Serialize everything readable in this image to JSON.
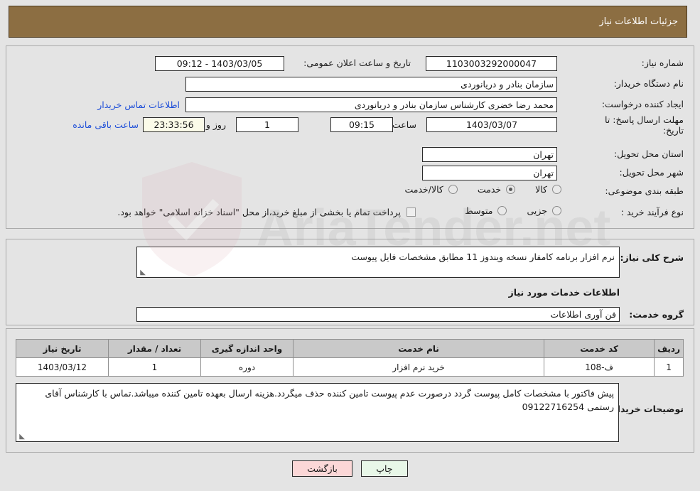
{
  "header": {
    "title": "جزئیات اطلاعات نیاز"
  },
  "form": {
    "need_number_label": "شماره نیاز:",
    "need_number_value": "1103003292000047",
    "announce_label": "تاریخ و ساعت اعلان عمومی:",
    "announce_value": "1403/03/05 - 09:12",
    "buyer_org_label": "نام دستگاه خریدار:",
    "buyer_org_value": "سازمان بنادر و دریانوردی",
    "creator_label": "ایجاد کننده درخواست:",
    "creator_value": "محمد رضا خضری کارشناس سازمان بنادر و دریانوردی",
    "contact_link": "اطلاعات تماس خریدار",
    "deadline_label": "مهلت ارسال پاسخ: تا تاریخ:",
    "deadline_date": "1403/03/07",
    "hour_label": "ساعت",
    "deadline_time": "09:15",
    "days_value": "1",
    "days_label": "روز و",
    "countdown_value": "23:33:56",
    "remaining_label": "ساعت باقی مانده",
    "province_label": "استان محل تحویل:",
    "province_value": "تهران",
    "city_label": "شهر محل تحویل:",
    "city_value": "تهران",
    "category_label": "طبقه بندی موضوعی:",
    "category_options": [
      {
        "label": "کالا",
        "selected": false
      },
      {
        "label": "خدمت",
        "selected": true
      },
      {
        "label": "کالا/خدمت",
        "selected": false
      }
    ],
    "process_label": "نوع فرآیند خرید :",
    "process_options": [
      {
        "label": "جزیی",
        "selected": false
      },
      {
        "label": "متوسط",
        "selected": false
      }
    ],
    "treasury_checkbox_checked": false,
    "treasury_text": "پرداخت تمام یا بخشی از مبلغ خرید،از محل \"اسناد خزانه اسلامی\" خواهد بود."
  },
  "description": {
    "need_desc_label": "شرح کلی نیاز:",
    "need_desc_value": "نرم افزار برنامه کامفار نسخه ویندوز 11 مطابق مشخصات فایل پیوست",
    "services_section_title": "اطلاعات خدمات مورد نیاز",
    "service_group_label": "گروه خدمت:",
    "service_group_value": "فن آوری اطلاعات"
  },
  "table": {
    "columns": [
      "ردیف",
      "کد خدمت",
      "نام خدمت",
      "واحد اندازه گیری",
      "تعداد / مقدار",
      "تاریخ نیاز"
    ],
    "rows": [
      {
        "radif": "1",
        "code": "ف-108",
        "name": "خرید نرم افزار",
        "unit": "دوره",
        "qty": "1",
        "date": "1403/03/12"
      }
    ],
    "notes_label": "توضیحات خریدار:",
    "notes_value": "پیش فاکتور با مشخصات کامل پیوست گردد درصورت عدم پیوست تامین کننده حذف میگردد.هزینه ارسال بعهده تامین کننده میباشد.تماس با کارشناس آقای رستمی 09122716254"
  },
  "buttons": {
    "print": "چاپ",
    "back": "بازگشت"
  },
  "watermark": {
    "text": "AriaTender.net"
  },
  "colors": {
    "header_bg": "#8c6e42",
    "page_bg": "#e4e4e4",
    "link": "#1f4fd8",
    "countdown_bg": "#fbfbe9",
    "print_btn_bg": "#e8f7e8",
    "back_btn_bg": "#fbd7d7",
    "table_header_bg": "#c9c9c9"
  }
}
